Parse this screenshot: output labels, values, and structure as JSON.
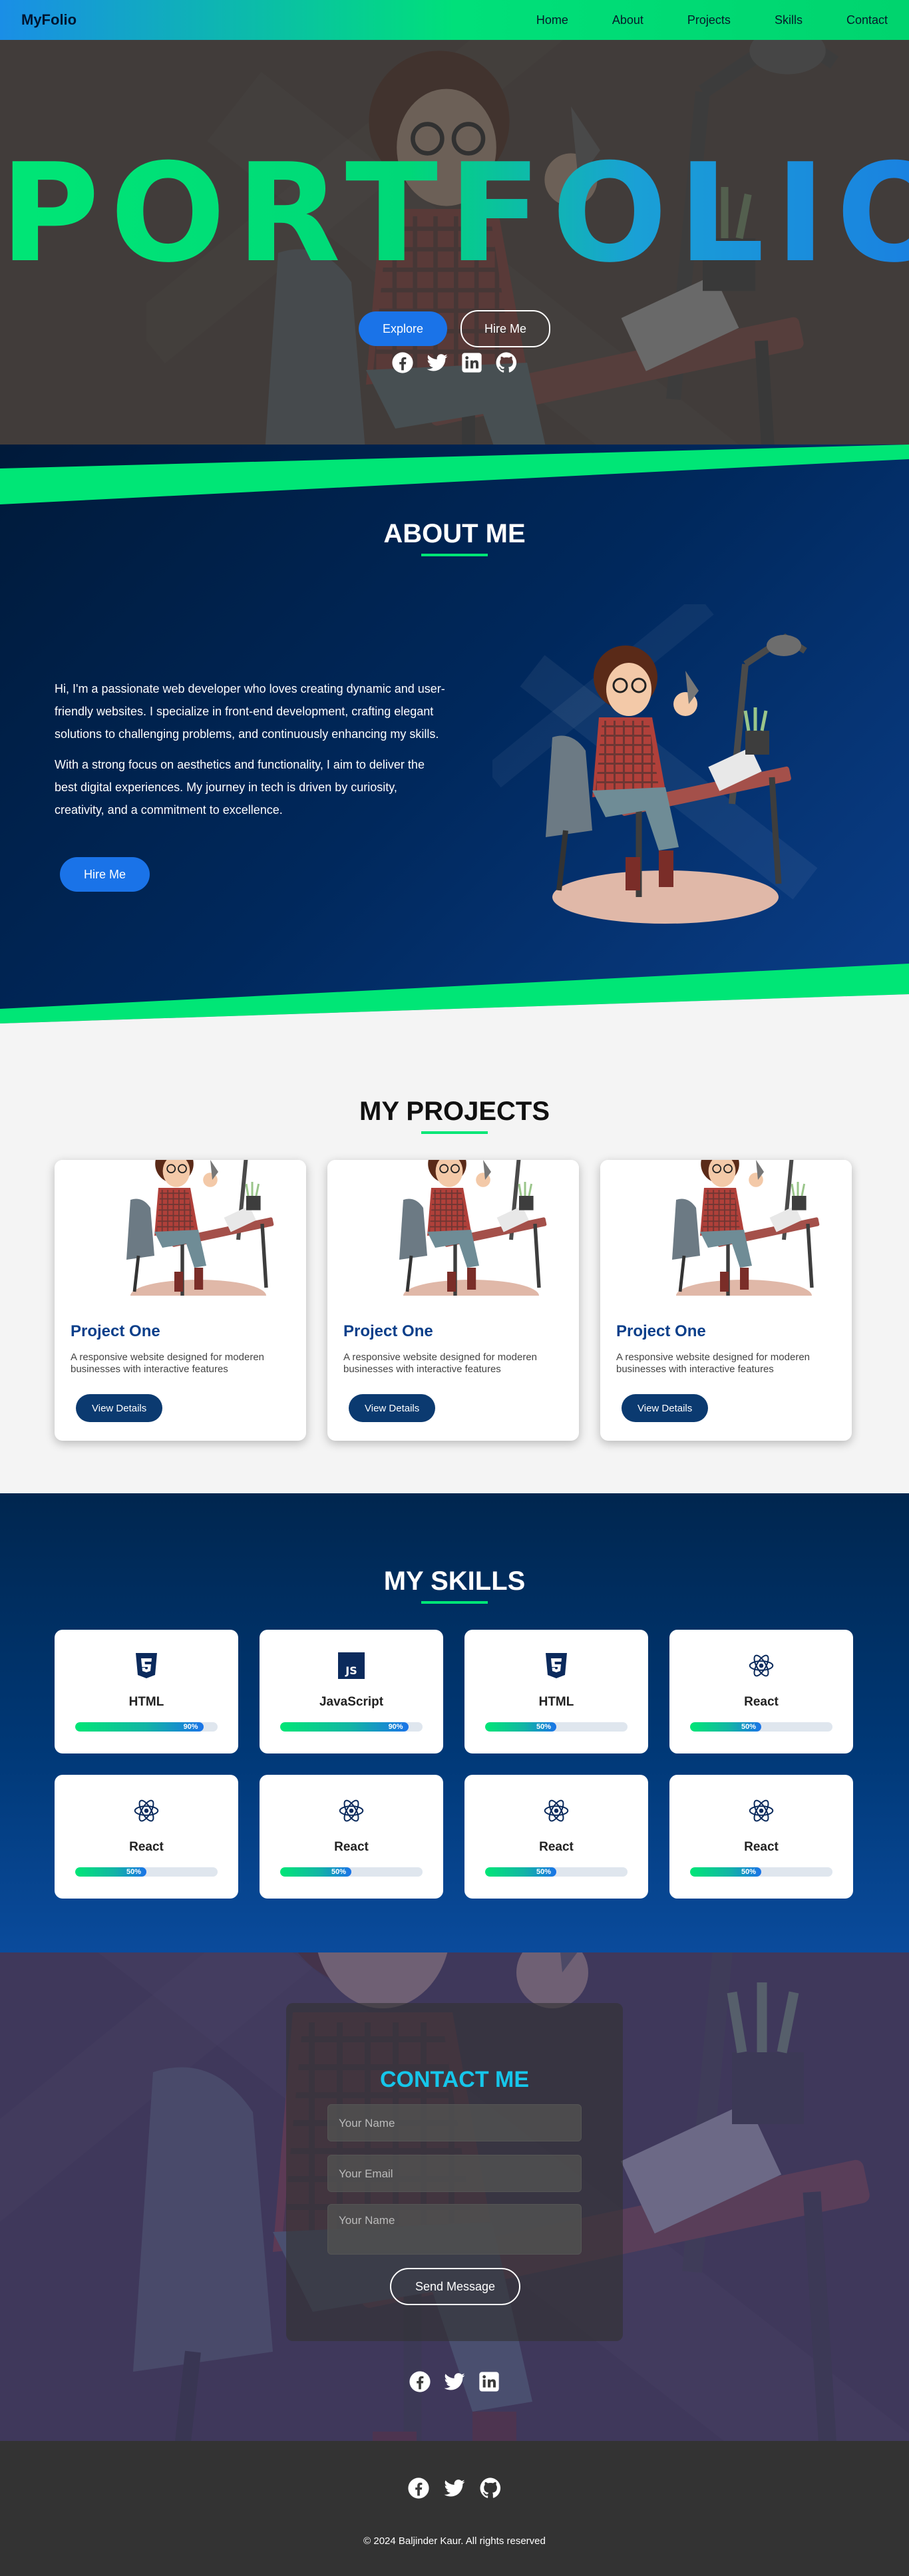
{
  "nav": {
    "brand": "MyFolio",
    "links": [
      "Home",
      "About",
      "Projects",
      "Skills",
      "Contact"
    ]
  },
  "hero": {
    "title": "PORTFOLIO",
    "explore_label": "Explore",
    "hire_label": "Hire Me",
    "social_icons": [
      "facebook-icon",
      "twitter-icon",
      "linkedin-icon",
      "github-icon"
    ]
  },
  "about": {
    "heading": "ABOUT ME",
    "paragraphs": [
      "Hi, I'm a passionate web developer who loves creating dynamic and user-friendly websites. I specialize in front-end development, crafting elegant solutions to challenging problems, and continuously enhancing my skills.",
      "With a strong focus on aesthetics and functionality, I aim to deliver the best digital experiences. My journey in tech is driven by curiosity, creativity, and a commitment to excellence."
    ],
    "hire_label": "Hire Me"
  },
  "projects": {
    "heading": "MY PROJECTS",
    "items": [
      {
        "title": "Project One",
        "desc": "A responsive website designed for moderen businesses with interactive features",
        "button": "View Details"
      },
      {
        "title": "Project One",
        "desc": "A responsive website designed for moderen businesses with interactive features",
        "button": "View Details"
      },
      {
        "title": "Project One",
        "desc": "A responsive website designed for moderen businesses with interactive features",
        "button": "View Details"
      }
    ]
  },
  "skills": {
    "heading": "MY SKILLS",
    "items": [
      {
        "name": "HTML",
        "percent": "90%",
        "level": 0.9,
        "icon": "html5-icon"
      },
      {
        "name": "JavaScript",
        "percent": "90%",
        "level": 0.9,
        "icon": "javascript-icon"
      },
      {
        "name": "HTML",
        "percent": "50%",
        "level": 0.5,
        "icon": "css3-icon"
      },
      {
        "name": "React",
        "percent": "50%",
        "level": 0.5,
        "icon": "react-icon"
      },
      {
        "name": "React",
        "percent": "50%",
        "level": 0.5,
        "icon": "react-icon"
      },
      {
        "name": "React",
        "percent": "50%",
        "level": 0.5,
        "icon": "react-icon"
      },
      {
        "name": "React",
        "percent": "50%",
        "level": 0.5,
        "icon": "react-icon"
      },
      {
        "name": "React",
        "percent": "50%",
        "level": 0.5,
        "icon": "react-icon"
      }
    ]
  },
  "contact": {
    "heading": "CONTACT ME",
    "name_placeholder": "Your Name",
    "email_placeholder": "Your Email",
    "message_placeholder": "Your  Name",
    "send_label": "Send Message",
    "social_icons": [
      "facebook-icon",
      "twitter-icon",
      "linkedin-icon"
    ]
  },
  "footer": {
    "social_icons": [
      "facebook-icon",
      "twitter-icon",
      "github-icon"
    ],
    "copyright": "© 2024 Baljinder Kaur. All rights reserved"
  },
  "colors": {
    "accent_green": "#00e676",
    "accent_blue": "#1a73e8",
    "navy": "#0b3a70",
    "contact_heading": "#16c6ea"
  }
}
